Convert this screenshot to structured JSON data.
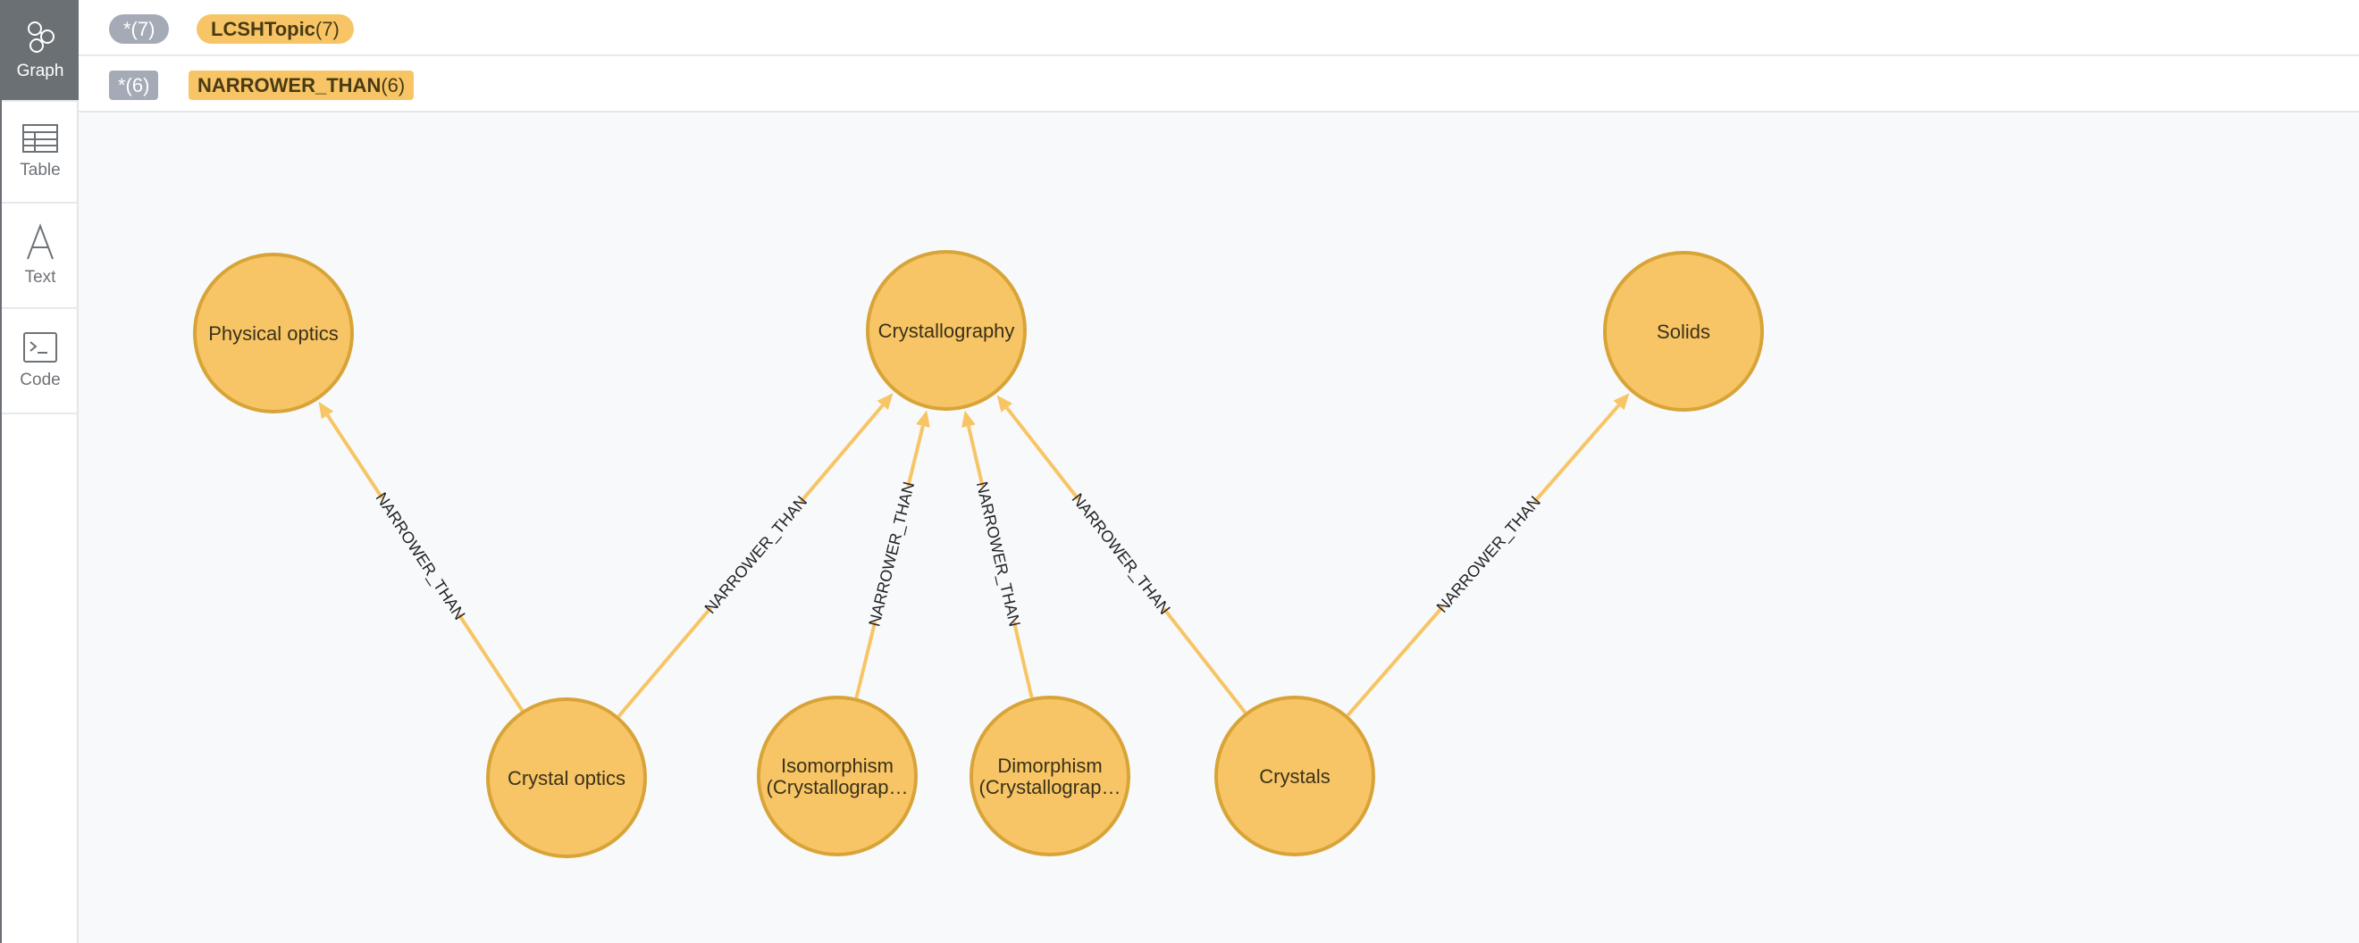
{
  "sidebar": {
    "items": [
      {
        "label": "Graph",
        "icon": "graph-icon",
        "active": true
      },
      {
        "label": "Table",
        "icon": "table-icon",
        "active": false
      },
      {
        "label": "Text",
        "icon": "text-icon",
        "active": false
      },
      {
        "label": "Code",
        "icon": "code-icon",
        "active": false
      }
    ]
  },
  "legend": {
    "nodes": {
      "all_label": "*(7)",
      "label_name": "LCSHTopic",
      "label_count": "(7)"
    },
    "relationships": {
      "all_label": "*(6)",
      "type_name": "NARROWER_THAN",
      "type_count": "(6)"
    }
  },
  "graph": {
    "nodes": [
      {
        "id": "physical_optics",
        "lines": [
          "Physical optics"
        ]
      },
      {
        "id": "crystallography",
        "lines": [
          "Crystallography"
        ]
      },
      {
        "id": "solids",
        "lines": [
          "Solids"
        ]
      },
      {
        "id": "crystal_optics",
        "lines": [
          "Crystal optics"
        ]
      },
      {
        "id": "isomorphism",
        "lines": [
          "Isomorphism",
          "(Crystallograp…"
        ]
      },
      {
        "id": "dimorphism",
        "lines": [
          "Dimorphism",
          "(Crystallograp…"
        ]
      },
      {
        "id": "crystals",
        "lines": [
          "Crystals"
        ]
      }
    ],
    "edges": [
      {
        "from": "crystal_optics",
        "to": "physical_optics",
        "label": "NARROWER_THAN"
      },
      {
        "from": "crystal_optics",
        "to": "crystallography",
        "label": "NARROWER_THAN"
      },
      {
        "from": "isomorphism",
        "to": "crystallography",
        "label": "NARROWER_THAN"
      },
      {
        "from": "dimorphism",
        "to": "crystallography",
        "label": "NARROWER_THAN"
      },
      {
        "from": "crystals",
        "to": "crystallography",
        "label": "NARROWER_THAN"
      },
      {
        "from": "crystals",
        "to": "solids",
        "label": "NARROWER_THAN"
      }
    ]
  },
  "colors": {
    "node_fill": "#f7c566",
    "node_stroke": "#d8a437",
    "all_pill": "#a5abb6",
    "sidebar_active": "#6b7075"
  }
}
